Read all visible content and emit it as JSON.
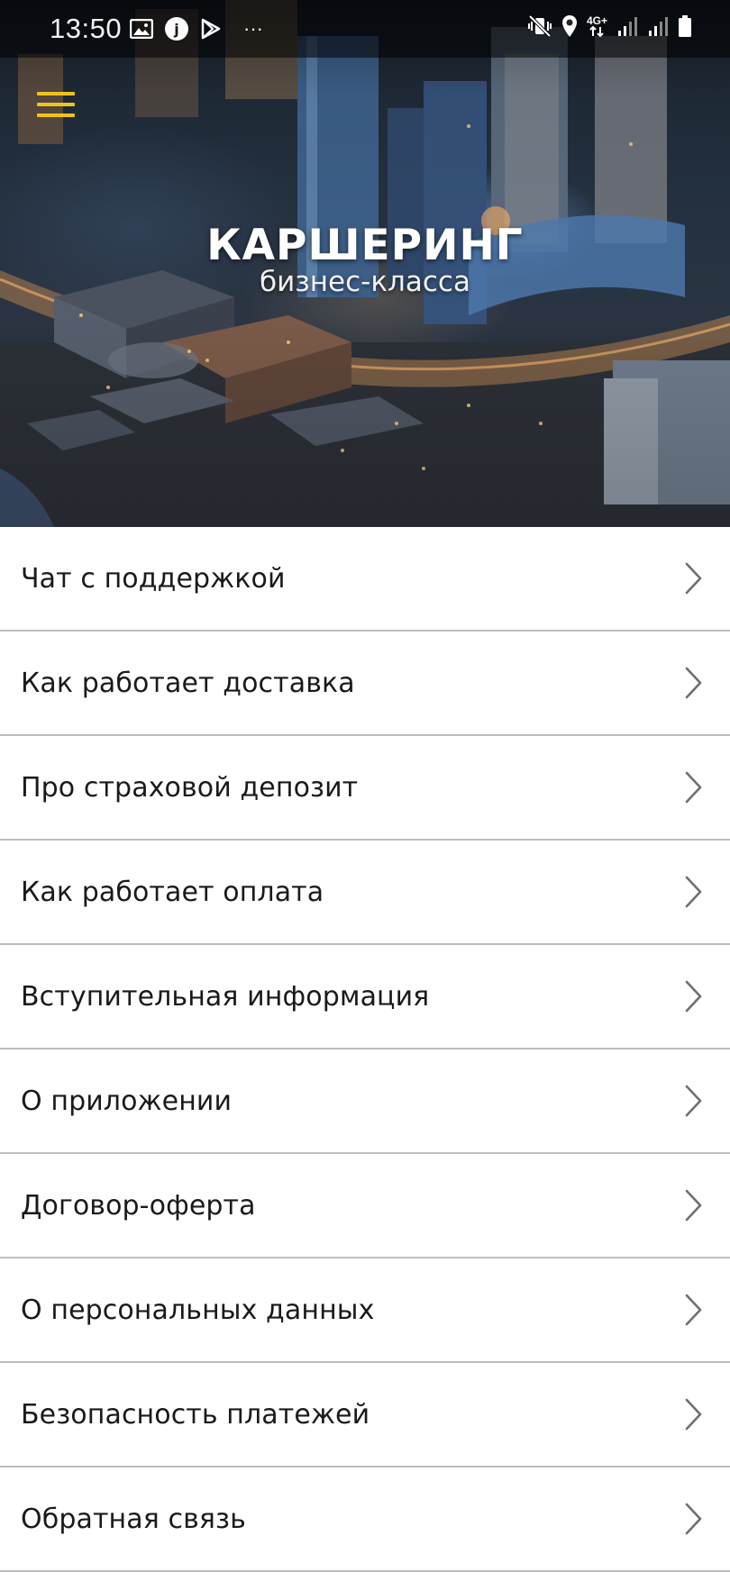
{
  "status_bar": {
    "time": "13:50",
    "left_icons": [
      "gallery-icon",
      "app-j-icon",
      "play-store-icon",
      "more-dots-icon"
    ],
    "right_icons": [
      "mute-vibrate-icon",
      "location-icon",
      "network-4g-icon",
      "signal-1-icon",
      "signal-2-icon",
      "battery-icon"
    ],
    "network_label": "4G+",
    "more": "···"
  },
  "header": {
    "menu_icon": "hamburger-menu-icon",
    "title": "КАРШЕРИНГ",
    "subtitle": "бизнес-класса",
    "accent_color": "#f2c21b"
  },
  "menu": {
    "items": [
      {
        "label": "Чат с поддержкой"
      },
      {
        "label": "Как работает доставка"
      },
      {
        "label": "Про страховой депозит"
      },
      {
        "label": "Как работает оплата"
      },
      {
        "label": "Вступительная информация"
      },
      {
        "label": "О приложении"
      },
      {
        "label": "Договор-оферта"
      },
      {
        "label": "О персональных данных"
      },
      {
        "label": "Безопасность платежей"
      },
      {
        "label": "Обратная связь"
      }
    ],
    "chevron_icon": "chevron-right-icon",
    "divider_color": "#bdbdbd"
  }
}
